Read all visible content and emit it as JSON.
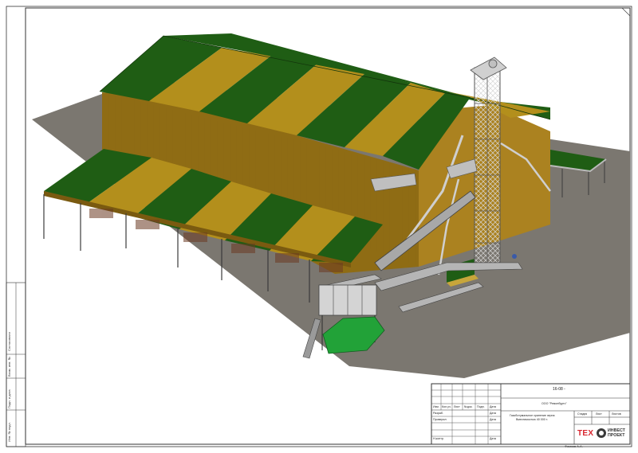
{
  "sheet": {
    "side_stamp": {
      "labels": [
        "Согласовано",
        "Взам. инв. №",
        "Подп. и дата",
        "Инв. № подл."
      ]
    },
    "title_block": {
      "drawing_code": "16-08 -",
      "company": "ООО \"Ремонбуртс\"",
      "object_line1": "Газоботумальное хранение зерна",
      "object_line2": "Вместимостью 40 000 т.",
      "row_headers": [
        "Изм.",
        "Кол.уч.",
        "Лист",
        "№док.",
        "Подп.",
        "Дата"
      ],
      "roles": [
        "Разраб.",
        "Проверил",
        "",
        "Н.контр."
      ],
      "date_cells": [
        "Дата",
        "Дата",
        "",
        "Дата"
      ],
      "sheet_headers": [
        "Стадия",
        "Лист",
        "Листов"
      ],
      "footer_name": "Фомков А.А."
    },
    "logo": {
      "main": "ТЕХ",
      "line1": "ИНВЕСТ",
      "line2": "ПРОЕКТ"
    }
  },
  "colors": {
    "roof_green": "#1f5d14",
    "roof_yellow": "#b38f1c",
    "wall_ochre": "#9a7518",
    "ground_gray": "#7b7770",
    "steel_gray": "#c2c2c2",
    "dryer_green": "#22a238",
    "logo_red": "#d8252e"
  }
}
